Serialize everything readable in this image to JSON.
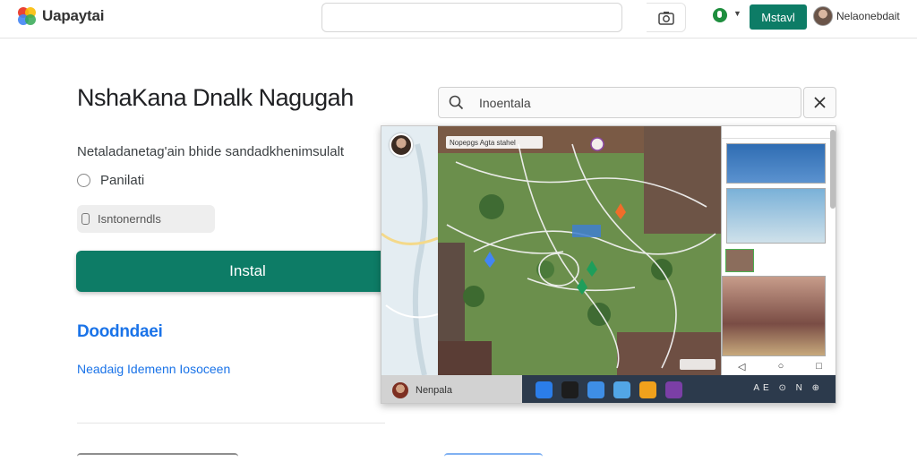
{
  "header": {
    "brand": "Uapaytai",
    "install_label": "Mstavl",
    "user_name": "Nelaonebdait"
  },
  "main": {
    "title": "NshaKana Dnalk Nagugah",
    "subtitle": "Netaladanetag'ain bhide sandadkhenimsulalt",
    "radio_label": "Panilati",
    "chip_label": "Isntonerndls",
    "install_button": "Instal",
    "download_heading": "Doodndaei",
    "download_link": "Neadaig Idemenn Iosoceen"
  },
  "search": {
    "value": "Inoentala"
  },
  "preview": {
    "map_label": "Nopepgs Agta stahel",
    "taskbar_name": "Nenpala",
    "app_colors": [
      "#2b7de9",
      "#1d1d1d",
      "#3e8ee6",
      "#52a6e6",
      "#f0a11c",
      "#7b3fa6"
    ],
    "tray_text": "AE ⊙ N ⊕"
  },
  "colors": {
    "accent": "#0d7c66",
    "link": "#1a73e8"
  },
  "icons": [
    "app-logo-icon",
    "lens-icon",
    "profile-icon",
    "search-icon",
    "close-icon",
    "radio-icon",
    "chip-icon"
  ]
}
